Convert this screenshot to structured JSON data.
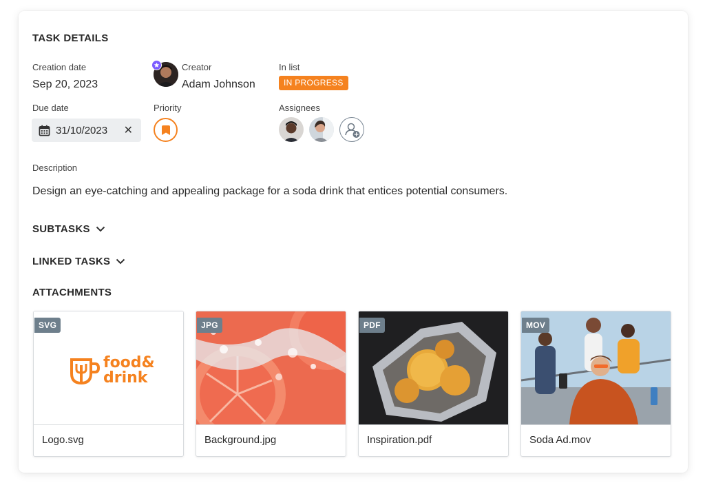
{
  "section_title": "TASK DETAILS",
  "creation": {
    "label": "Creation date",
    "value": "Sep 20, 2023"
  },
  "creator": {
    "label": "Creator",
    "name": "Adam Johnson"
  },
  "in_list": {
    "label": "In list",
    "status": "IN PROGRESS"
  },
  "due": {
    "label": "Due date",
    "value": "31/10/2023"
  },
  "priority": {
    "label": "Priority"
  },
  "assignees": {
    "label": "Assignees"
  },
  "description": {
    "label": "Description",
    "text": "Design an eye-catching and appealing package for a soda drink that entices potential consumers."
  },
  "subtasks_label": "SUBTASKS",
  "linked_label": "LINKED TASKS",
  "attachments_label": "ATTACHMENTS",
  "attachments": [
    {
      "type": "SVG",
      "name": "Logo.svg",
      "logo_line1": "food&",
      "logo_line2": "drink"
    },
    {
      "type": "JPG",
      "name": "Background.jpg"
    },
    {
      "type": "PDF",
      "name": "Inspiration.pdf"
    },
    {
      "type": "MOV",
      "name": "Soda Ad.mov"
    }
  ],
  "colors": {
    "accent": "#f5821f",
    "badge_gray": "#6e7f8c",
    "creator_star": "#7b5cff"
  },
  "icons": [
    "calendar-icon",
    "close-icon",
    "bookmark-icon",
    "chevron-down-icon",
    "add-user-icon",
    "star-icon"
  ]
}
